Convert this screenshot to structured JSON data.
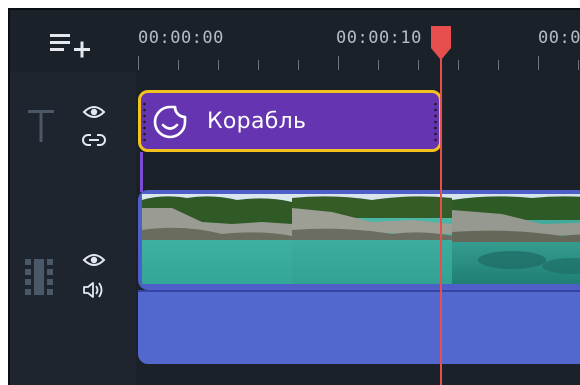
{
  "timeline": {
    "timecodes": [
      "00:00:00",
      "00:00:10",
      "00:0"
    ],
    "title_clip": {
      "label": "Корабль"
    }
  },
  "colors": {
    "background": "#1c232c",
    "title_clip_fill": "#6535b1",
    "title_clip_border": "#f4c21c",
    "video_clip": "#4e5fc8",
    "playhead": "#e74f4f"
  },
  "icons": {
    "add_track": "add-track-icon",
    "title_track": "title-track-icon",
    "visibility": "eye-icon",
    "link": "link-icon",
    "video_track": "video-track-icon",
    "audio": "speaker-icon",
    "sticker": "sticker-icon"
  }
}
